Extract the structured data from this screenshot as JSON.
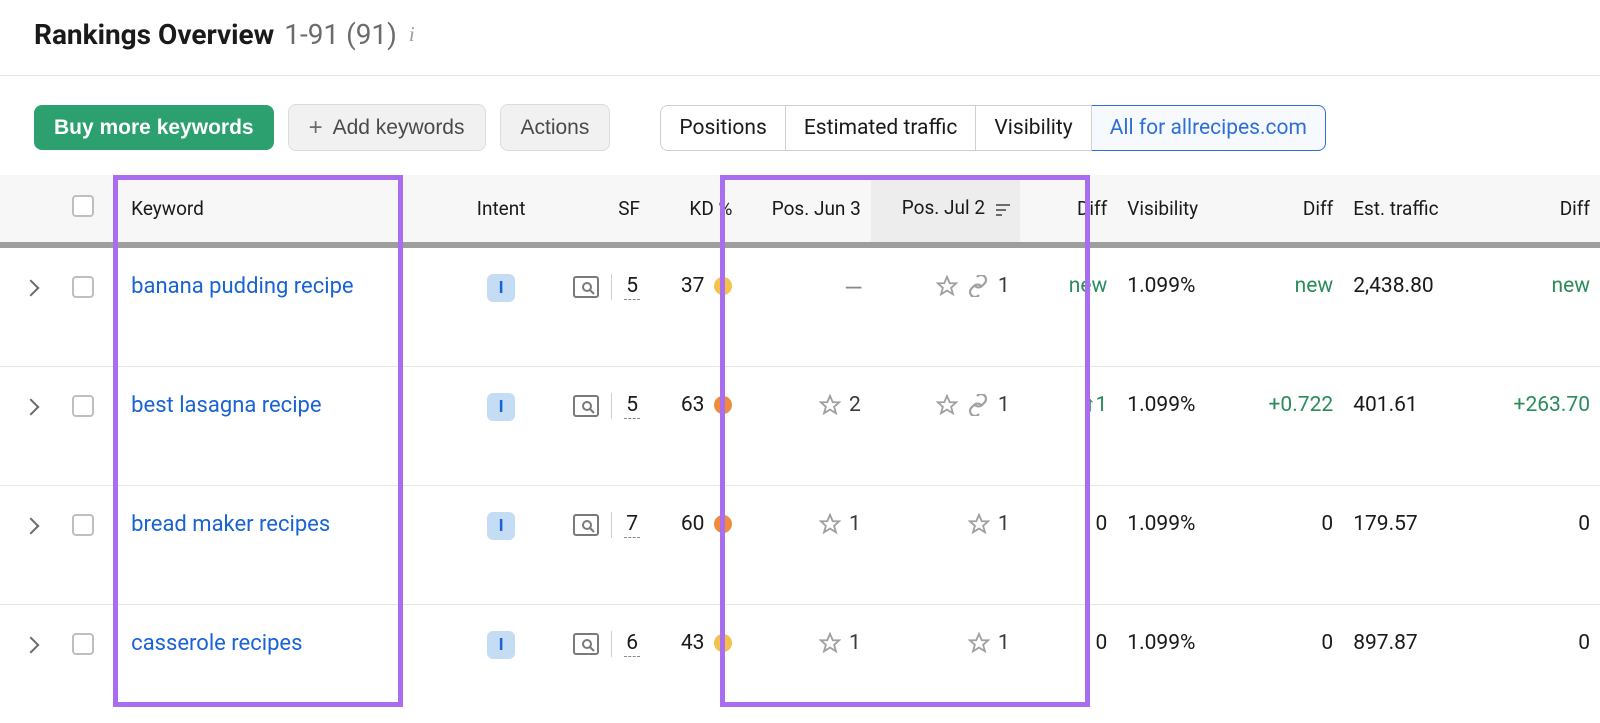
{
  "header": {
    "title": "Rankings Overview",
    "range": "1-91 (91)"
  },
  "toolbar": {
    "buy": "Buy more keywords",
    "add": "Add keywords",
    "actions": "Actions",
    "seg": {
      "positions": "Positions",
      "traffic": "Estimated traffic",
      "visibility": "Visibility",
      "domain": "All for allrecipes.com"
    }
  },
  "columns": {
    "keyword": "Keyword",
    "intent": "Intent",
    "sf": "SF",
    "kd": "KD %",
    "pos1": "Pos. Jun 3",
    "pos2": "Pos. Jul 2",
    "diff1": "Diff",
    "visibility": "Visibility",
    "diff2": "Diff",
    "traffic": "Est. traffic",
    "diff3": "Diff"
  },
  "rows": [
    {
      "keyword": "banana pudding recipe",
      "intent": "I",
      "sf": "5",
      "kd": "37",
      "kd_tone": "yellow",
      "pos1": "—",
      "pos1_star": false,
      "pos2": "1",
      "pos2_link": true,
      "diff1": "new",
      "diff1_class": "diff-green",
      "visibility": "1.099%",
      "diff2": "new",
      "diff2_class": "diff-green",
      "traffic": "2,438.80",
      "diff3": "new",
      "diff3_class": "diff-green"
    },
    {
      "keyword": "best lasagna recipe",
      "intent": "I",
      "sf": "5",
      "kd": "63",
      "kd_tone": "orange",
      "pos1": "2",
      "pos1_star": true,
      "pos2": "1",
      "pos2_link": true,
      "diff1": "↑1",
      "diff1_class": "diff-green",
      "visibility": "1.099%",
      "diff2": "+0.722",
      "diff2_class": "diff-green",
      "traffic": "401.61",
      "diff3": "+263.70",
      "diff3_class": "diff-green"
    },
    {
      "keyword": "bread maker recipes",
      "intent": "I",
      "sf": "7",
      "kd": "60",
      "kd_tone": "orange",
      "pos1": "1",
      "pos1_star": true,
      "pos2": "1",
      "pos2_link": false,
      "diff1": "0",
      "diff1_class": "diff-zero",
      "visibility": "1.099%",
      "diff2": "0",
      "diff2_class": "diff-zero",
      "traffic": "179.57",
      "diff3": "0",
      "diff3_class": "diff-zero"
    },
    {
      "keyword": "casserole recipes",
      "intent": "I",
      "sf": "6",
      "kd": "43",
      "kd_tone": "yellow",
      "pos1": "1",
      "pos1_star": true,
      "pos2": "1",
      "pos2_link": false,
      "diff1": "0",
      "diff1_class": "diff-zero",
      "visibility": "1.099%",
      "diff2": "0",
      "diff2_class": "diff-zero",
      "traffic": "897.87",
      "diff3": "0",
      "diff3_class": "diff-zero"
    }
  ]
}
